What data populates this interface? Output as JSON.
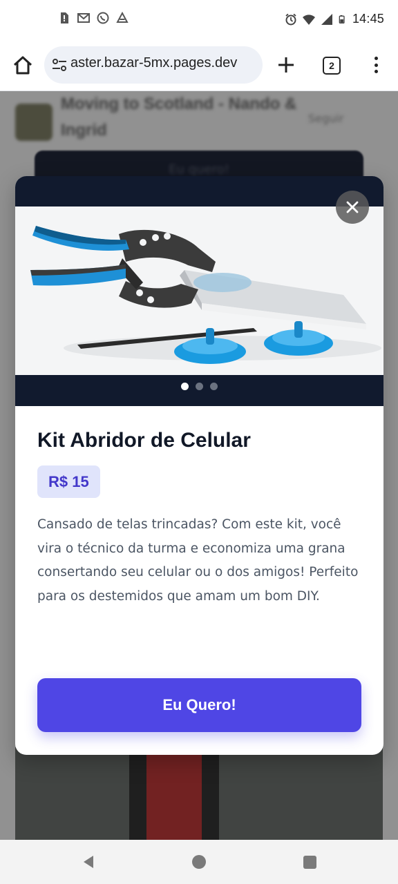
{
  "status_bar": {
    "time": "14:45",
    "left_icons": [
      "sim-icon",
      "gmail-icon",
      "whatsapp-icon",
      "drive-icon"
    ],
    "right_icons": [
      "alarm-icon",
      "wifi-icon",
      "signal-icon",
      "battery-icon"
    ]
  },
  "browser": {
    "url": "aster.bazar-5mx.pages.dev",
    "tab_count": "2"
  },
  "background_page": {
    "title": "Moving to Scotland - Nando & Ingrid",
    "follow_label": "Seguir",
    "button_label": "Eu quero!"
  },
  "modal": {
    "carousel": {
      "slide_count": 3,
      "active_index": 0,
      "image_alt": "Kit abridor de celular com alicate de ventosa"
    },
    "title": "Kit Abridor de Celular",
    "price": "R$ 15",
    "description": "Cansado de telas trincadas? Com este kit, você vira o técnico da turma e economiza uma grana consertando seu celular ou o dos amigos! Perfeito para os destemidos que amam um bom DIY.",
    "cta_label": "Eu Quero!"
  },
  "colors": {
    "accent": "#4f46e5",
    "price_bg": "#e0e4fb",
    "price_text": "#4338ca",
    "carousel_bg": "#111a2e",
    "tool_blue": "#1e90d6"
  },
  "nav_bar": {
    "buttons": [
      "back-icon",
      "home-icon",
      "recents-icon"
    ]
  }
}
